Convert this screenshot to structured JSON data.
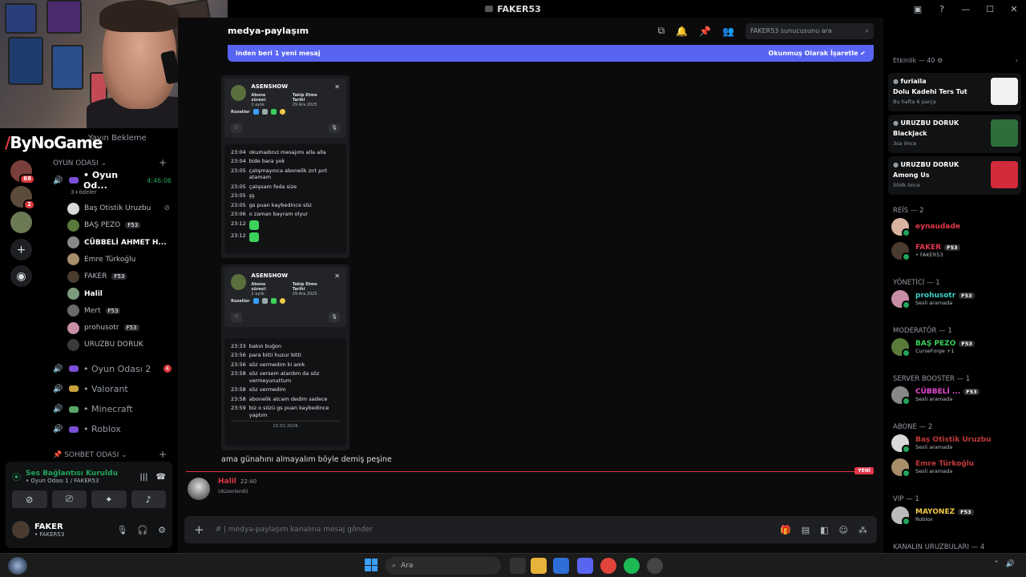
{
  "window": {
    "title": "FAKER53"
  },
  "overlay": {
    "brand_name": "ByNoGame",
    "ghost_channel": "Yayın Bekleme"
  },
  "rail": {
    "servers": [
      {
        "color": "#7a3f3a",
        "badge": "68"
      },
      {
        "color": "#5b4b3b",
        "badge": "2"
      },
      {
        "color": "#6b7a55",
        "badge": ""
      }
    ],
    "add_icon": "plus-icon",
    "discover_icon": "compass-icon"
  },
  "sidebar": {
    "category_voice": "OYUN ODASI",
    "category_chat": "SOHBET ODASI",
    "active_channel": {
      "name": "• Oyun Od...",
      "time": "4:46:06",
      "subtitle": "3+ödeler"
    },
    "voice_users": [
      {
        "name": "Baş Otistik Uruzbu",
        "tag": "",
        "color": "#d9d9d9",
        "bold": false
      },
      {
        "name": "BAŞ PEZO",
        "tag": "F53",
        "color": "#5a7a3a",
        "bold": false
      },
      {
        "name": "CÜBBELİ AHMET H...",
        "tag": "",
        "color": "#888",
        "bold": true
      },
      {
        "name": "Emre Türkoğlu",
        "tag": "",
        "color": "#a88d6a",
        "bold": false
      },
      {
        "name": "FAKER",
        "tag": "F53",
        "color": "#4a3b2f",
        "bold": false
      },
      {
        "name": "Halil",
        "tag": "",
        "color": "#7d9a7d",
        "bold": true
      },
      {
        "name": "Mert",
        "tag": "F53",
        "color": "#6a6a6a",
        "bold": false
      },
      {
        "name": "prohusotr",
        "tag": "F53",
        "color": "#c78ea6",
        "bold": false
      },
      {
        "name": "URUZBU DORUK",
        "tag": "",
        "color": "#3a3a3a",
        "bold": false
      }
    ],
    "other_channels": [
      {
        "name": "• Oyun Odası 2",
        "count": "4",
        "gem": "#7b4fd6"
      },
      {
        "name": "• Valorant",
        "count": "",
        "gem": "#c8a13a"
      },
      {
        "name": "• Minecraft",
        "count": "",
        "gem": "#5aa86b"
      },
      {
        "name": "• Roblox",
        "count": "",
        "gem": "#7b4fd6"
      }
    ]
  },
  "voice_panel": {
    "status": "Ses Bağlantısı Kuruldu",
    "location": "• Oyun Odası 1 / FAKER53",
    "user_name": "FAKER",
    "user_status": "• FAKER53"
  },
  "chat": {
    "channel_name": "medya-paylaşım",
    "new_bar_left": "inden beri 1 yeni mesaj",
    "new_bar_right": "Okunmuş Olarak İşaretle",
    "search_placeholder": "FAKER53 sunucusunu ara",
    "shots": [
      {
        "card_name": "ASENSHOW",
        "sub_label": "Abone süresi:",
        "sub_value": "2 aylık",
        "follow_label": "Takip Etme Tarihi",
        "follow_value": "29 Ara 2025",
        "badges_label": "Rozetler",
        "lines": [
          {
            "t": "23:04",
            "m": "okumadınız mesajımı alla alla"
          },
          {
            "t": "23:04",
            "m": "bide bara yok"
          },
          {
            "t": "23:05",
            "m": "çalışmayınca abonelik zırt pırt atamam"
          },
          {
            "t": "23:05",
            "m": "çalışsam feda size"
          },
          {
            "t": "23:05",
            "m": "şş"
          },
          {
            "t": "23:05",
            "m": "gs puan kaybedince söz"
          },
          {
            "t": "23:06",
            "m": "o zaman bayram olyur"
          },
          {
            "t": "23:12",
            "m": ""
          },
          {
            "t": "23:12",
            "m": ""
          }
        ],
        "date": ""
      },
      {
        "card_name": "ASENSHOW",
        "sub_label": "Abone süresi:",
        "sub_value": "2 aylık",
        "follow_label": "Takip Etme Tarihi",
        "follow_value": "29 Ara 2025",
        "badges_label": "Rozetler",
        "lines": [
          {
            "t": "23:33",
            "m": "bakın buğon"
          },
          {
            "t": "23:56",
            "m": "para bitti huzur bitti"
          },
          {
            "t": "23:56",
            "m": "söz vermedim ki amk"
          },
          {
            "t": "23:58",
            "m": "söz versem atardım da söz vermeyunuttum"
          },
          {
            "t": "23:58",
            "m": "söz vermedim"
          },
          {
            "t": "23:58",
            "m": "abonelik atcam dedim sadece"
          },
          {
            "t": "23:59",
            "m": "biz o sözü gs puan kaybedince yaptım"
          }
        ],
        "date": "15.02.2026"
      }
    ],
    "message_text": "ama günahını almayalım böyle demiş peşine",
    "new_label": "YENİ",
    "last_author": "Halil",
    "last_time": "22:40",
    "last_edited": "(düzenlendi)",
    "composer_placeholder": "medya-paylaşım kanalına mesaj gönder"
  },
  "members": {
    "events_header": "Etkinlik — 40",
    "events": [
      {
        "user": "furiaila",
        "title": "Dolu Kadehi Ters Tut",
        "detail": "Bu hafta 6 parça",
        "thumb": "#f2f2f2"
      },
      {
        "user": "URUZBU DORUK",
        "title": "Blackjack",
        "detail": "3sa önce",
        "thumb": "#2d6e3a"
      },
      {
        "user": "URUZBU DORUK",
        "title": "Among Us",
        "detail": "50dk önce",
        "thumb": "#d22b3a"
      }
    ],
    "groups": [
      {
        "label": "REİS — 2",
        "items": [
          {
            "name": "eynaudade",
            "tag": "",
            "status": "",
            "color": "#e0364a",
            "av": "#d9b3a0"
          },
          {
            "name": "FAKER",
            "tag": "F53",
            "status": "• FAKER53",
            "color": "#e0364a",
            "av": "#4a3b2f"
          }
        ]
      },
      {
        "label": "YÖNETİCİ — 1",
        "items": [
          {
            "name": "prohusotr",
            "tag": "F53",
            "status": "Sesli aramada",
            "color": "#3bd1c9",
            "av": "#c78ea6"
          }
        ]
      },
      {
        "label": "MODERATÖR — 1",
        "items": [
          {
            "name": "BAŞ PEZO",
            "tag": "F53",
            "status": "CurseForge +1",
            "color": "#3bd15b",
            "av": "#5a7a3a"
          }
        ]
      },
      {
        "label": "Server Booster — 1",
        "items": [
          {
            "name": "CÜBBELİ ...",
            "tag": "F53",
            "status": "Sesli aramada",
            "color": "#e84bd6",
            "av": "#888"
          }
        ]
      },
      {
        "label": "Abone — 2",
        "items": [
          {
            "name": "Baş Otistik Uruzbu",
            "tag": "",
            "status": "Sesli aramada",
            "color": "#c23a3a",
            "av": "#d9d9d9"
          },
          {
            "name": "Emre Türkoğlu",
            "tag": "",
            "status": "Sesli aramada",
            "color": "#c23a3a",
            "av": "#a88d6a"
          }
        ]
      },
      {
        "label": "VIP — 1",
        "items": [
          {
            "name": "MAYONEZ",
            "tag": "F53",
            "status": "Roblox",
            "color": "#f2c94c",
            "av": "#bcbcbc"
          }
        ]
      },
      {
        "label": "KANALIN URUZBULARI — 4",
        "items": []
      }
    ]
  },
  "taskbar": {
    "search_placeholder": "Ara"
  }
}
